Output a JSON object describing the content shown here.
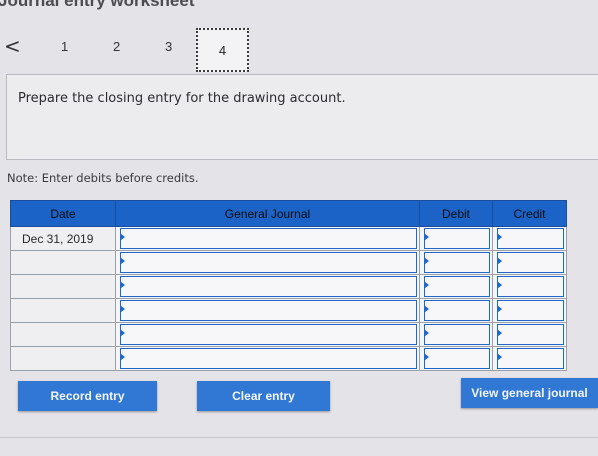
{
  "header": {
    "title": "Journal entry worksheet"
  },
  "pager": {
    "prev_glyph": "<",
    "pages": [
      "1",
      "2",
      "3"
    ],
    "current": "4"
  },
  "question": {
    "text": "Prepare the closing entry for the drawing account."
  },
  "note": "Note: Enter debits before credits.",
  "journal": {
    "columns": [
      "Date",
      "General Journal",
      "Debit",
      "Credit"
    ],
    "rows": [
      {
        "date": "Dec 31, 2019"
      },
      {
        "date": ""
      },
      {
        "date": ""
      },
      {
        "date": ""
      },
      {
        "date": ""
      },
      {
        "date": ""
      }
    ]
  },
  "buttons": {
    "record": "Record entry",
    "clear": "Clear entry",
    "view": "View general journal"
  },
  "colors": {
    "accent": "#1b63c6",
    "button": "#3178d4"
  }
}
